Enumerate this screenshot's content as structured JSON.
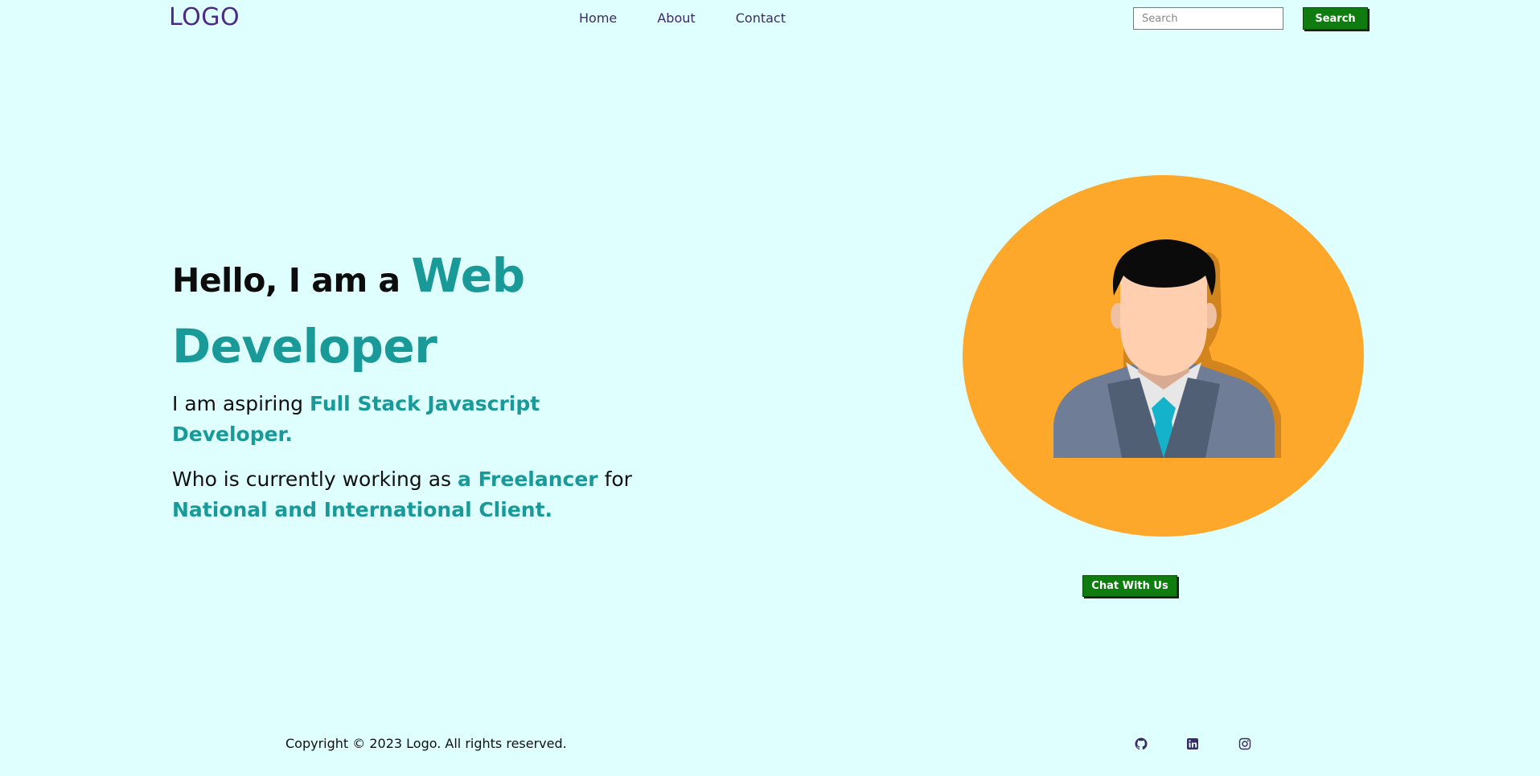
{
  "header": {
    "logo": "LOGO",
    "nav": [
      "Home",
      "About",
      "Contact"
    ],
    "search_placeholder": "Search",
    "search_button": "Search"
  },
  "hero": {
    "greeting": "Hello, I am a ",
    "role_word1": "Web",
    "role_word2": "Developer",
    "para1_prefix": "I am aspiring ",
    "para1_highlight": "Full Stack Javascript Developer.",
    "para2_prefix": "Who is currently working as ",
    "para2_highlight1": "a Freelancer",
    "para2_mid": " for ",
    "para2_highlight2": "National and International Client."
  },
  "avatar": {
    "icon": "user-avatar-illustration",
    "bg_color": "#fda82a"
  },
  "chat_button": "Chat With Us",
  "footer": {
    "copyright": "Copyright © 2023 Logo. All rights reserved.",
    "social_icons": [
      "github-icon",
      "linkedin-icon",
      "instagram-icon"
    ]
  },
  "colors": {
    "background": "#dffffe",
    "accent": "#199a99",
    "button": "#0f7c0f",
    "logo": "#4b2a8a"
  }
}
